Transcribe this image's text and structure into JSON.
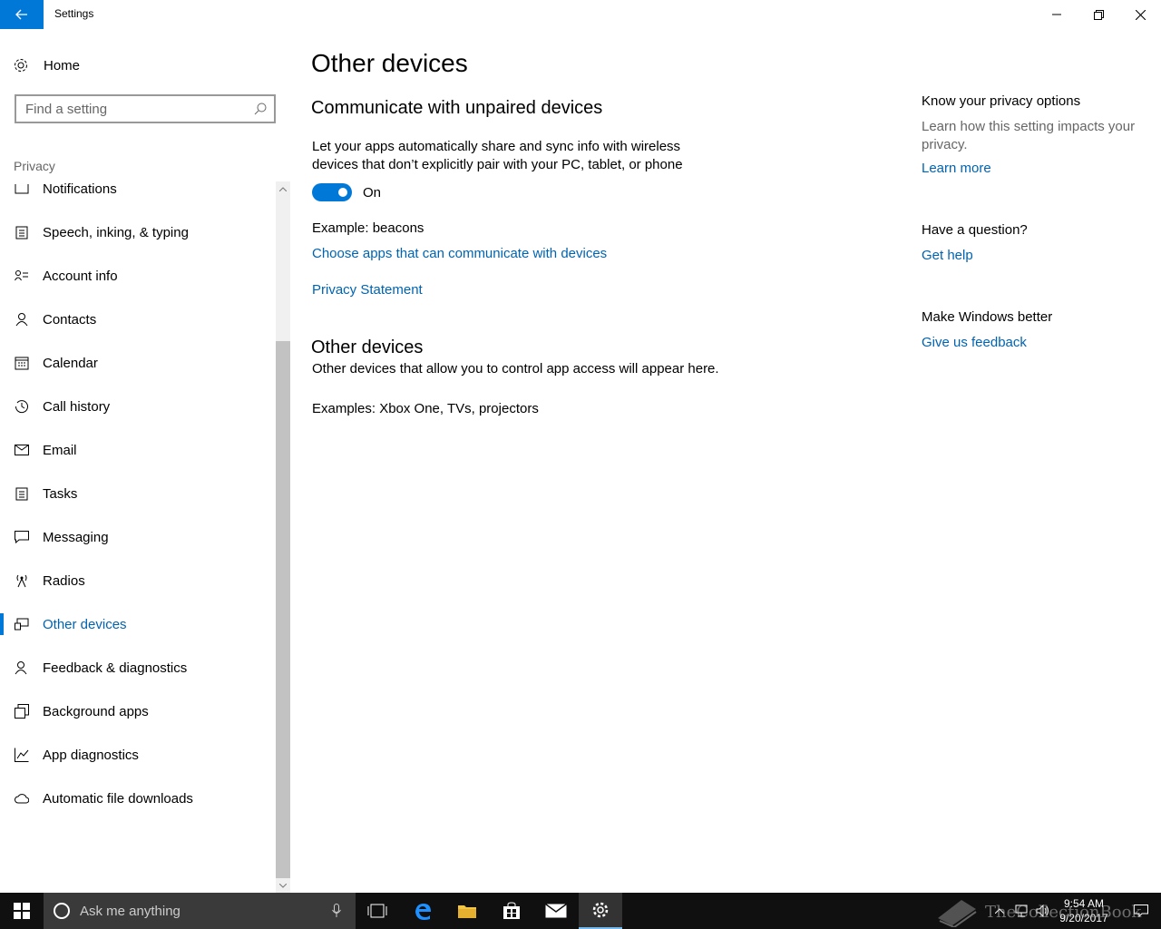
{
  "window": {
    "title": "Settings",
    "accent": "#0078d7",
    "link_color": "#0063b1"
  },
  "nav": {
    "home_label": "Home",
    "search_placeholder": "Find a setting",
    "section_label": "Privacy",
    "items": [
      {
        "label": "Notifications",
        "icon": "notifications-icon"
      },
      {
        "label": "Speech, inking, & typing",
        "icon": "clipboard-icon"
      },
      {
        "label": "Account info",
        "icon": "account-info-icon"
      },
      {
        "label": "Contacts",
        "icon": "contacts-icon"
      },
      {
        "label": "Calendar",
        "icon": "calendar-icon"
      },
      {
        "label": "Call history",
        "icon": "history-icon"
      },
      {
        "label": "Email",
        "icon": "email-icon"
      },
      {
        "label": "Tasks",
        "icon": "tasks-icon"
      },
      {
        "label": "Messaging",
        "icon": "messaging-icon"
      },
      {
        "label": "Radios",
        "icon": "radio-tower-icon"
      },
      {
        "label": "Other devices",
        "icon": "devices-icon",
        "selected": true
      },
      {
        "label": "Feedback & diagnostics",
        "icon": "feedback-icon"
      },
      {
        "label": "Background apps",
        "icon": "background-apps-icon"
      },
      {
        "label": "App diagnostics",
        "icon": "chart-icon"
      },
      {
        "label": "Automatic file downloads",
        "icon": "cloud-icon"
      }
    ]
  },
  "main": {
    "title": "Other devices",
    "section1": {
      "heading": "Communicate with unpaired devices",
      "description": "Let your apps automatically share and sync info with wireless devices that don’t explicitly pair with your PC, tablet, or phone",
      "toggle_state": "On",
      "example": "Example: beacons",
      "choose_link": "Choose apps that can communicate with devices",
      "privacy_link": "Privacy Statement"
    },
    "section2": {
      "heading": "Other devices",
      "description": "Other devices that allow you to control app access will appear here.",
      "example": "Examples: Xbox One, TVs, projectors"
    }
  },
  "side": {
    "privacy_heading": "Know your privacy options",
    "privacy_text": "Learn how this setting impacts your privacy.",
    "learn_more": "Learn more",
    "question_heading": "Have a question?",
    "get_help": "Get help",
    "better_heading": "Make Windows better",
    "feedback_link": "Give us feedback"
  },
  "taskbar": {
    "search_placeholder": "Ask me anything",
    "time": "9:54 AM",
    "date": "9/20/2017",
    "watermark": "TheCollectionBook"
  }
}
